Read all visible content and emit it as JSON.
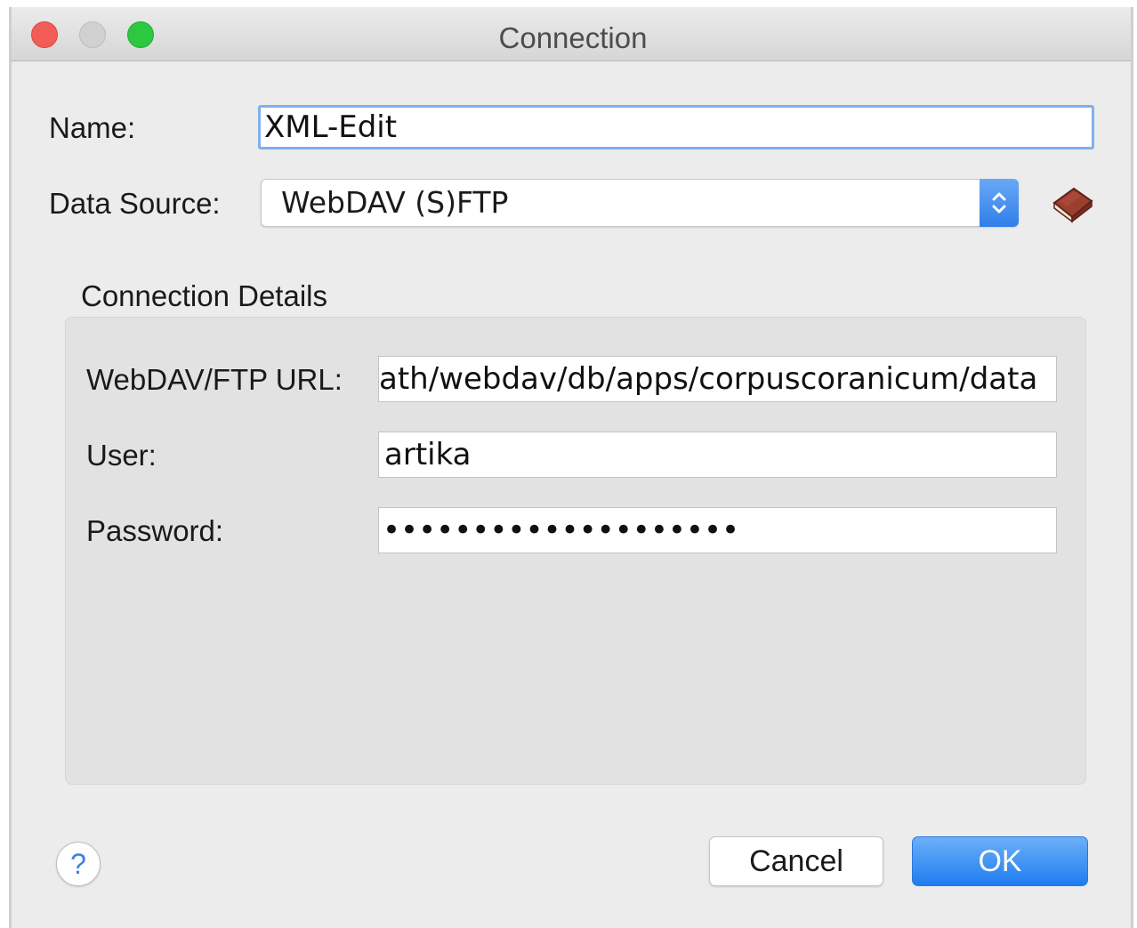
{
  "window": {
    "title": "Connection"
  },
  "form": {
    "name_label": "Name:",
    "name_value": "XML-Edit",
    "data_source_label": "Data Source:",
    "data_source_value": "WebDAV (S)FTP"
  },
  "connection_details": {
    "title": "Connection Details",
    "url_label": "WebDAV/FTP URL:",
    "url_value": "ath/webdav/db/apps/corpuscoranicum/data",
    "user_label": "User:",
    "user_value": "artika",
    "password_label": "Password:",
    "password_value": "••••••••••••••••••••"
  },
  "footer": {
    "help_label": "?",
    "cancel_label": "Cancel",
    "ok_label": "OK"
  },
  "colors": {
    "accent": "#2f7fe9",
    "close": "#f25d57",
    "zoom": "#2bc840",
    "book": "#8b3a2e"
  },
  "icons": {
    "data_source_details": "book-icon",
    "select_arrows": "updown-chevron-icon"
  }
}
